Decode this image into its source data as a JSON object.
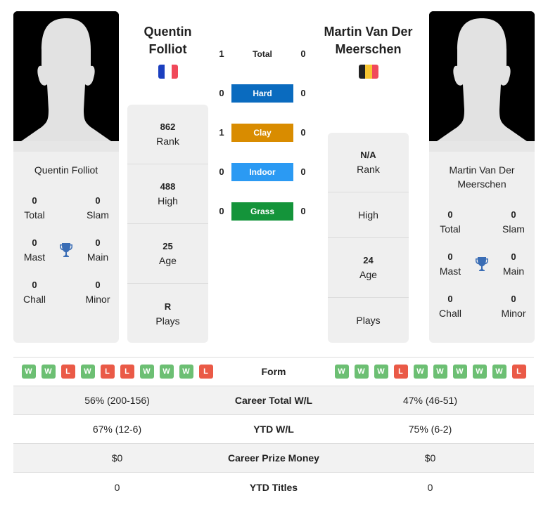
{
  "colors": {
    "hard": "#0a6bbf",
    "clay": "#d98c00",
    "indoor": "#2b9af3",
    "grass": "#14943a",
    "win": "#6cbf73",
    "loss": "#ea5a47",
    "trophy": "#3a6db5"
  },
  "player1": {
    "name": "Quentin Folliot",
    "name_line1": "Quentin",
    "name_line2": "Folliot",
    "flag": "France",
    "flag_colors": [
      "#1b3fbf",
      "#ffffff",
      "#f0495a"
    ],
    "card_name": "Quentin Folliot",
    "titles": {
      "total": {
        "value": "0",
        "label": "Total"
      },
      "slam": {
        "value": "0",
        "label": "Slam"
      },
      "mast": {
        "value": "0",
        "label": "Mast"
      },
      "main": {
        "value": "0",
        "label": "Main"
      },
      "chall": {
        "value": "0",
        "label": "Chall"
      },
      "minor": {
        "value": "0",
        "label": "Minor"
      }
    },
    "stats": {
      "rank": {
        "value": "862",
        "label": "Rank"
      },
      "high": {
        "value": "488",
        "label": "High"
      },
      "age": {
        "value": "25",
        "label": "Age"
      },
      "plays": {
        "value": "R",
        "label": "Plays"
      }
    }
  },
  "player2": {
    "name": "Martin Van Der Meerschen",
    "name_line1": "Martin Van Der",
    "name_line2": "Meerschen",
    "flag": "Belgium",
    "flag_colors": [
      "#222222",
      "#f7c531",
      "#f0495a"
    ],
    "card_name_line1": "Martin Van Der",
    "card_name_line2": "Meerschen",
    "titles": {
      "total": {
        "value": "0",
        "label": "Total"
      },
      "slam": {
        "value": "0",
        "label": "Slam"
      },
      "mast": {
        "value": "0",
        "label": "Mast"
      },
      "main": {
        "value": "0",
        "label": "Main"
      },
      "chall": {
        "value": "0",
        "label": "Chall"
      },
      "minor": {
        "value": "0",
        "label": "Minor"
      }
    },
    "stats": {
      "rank": {
        "value": "N/A",
        "label": "Rank"
      },
      "high": {
        "value": "",
        "label": "High"
      },
      "age": {
        "value": "24",
        "label": "Age"
      },
      "plays": {
        "value": "",
        "label": "Plays"
      }
    }
  },
  "h2h": [
    {
      "label": "Total",
      "p1": "1",
      "p2": "0",
      "surface": "total"
    },
    {
      "label": "Hard",
      "p1": "0",
      "p2": "0",
      "surface": "hard"
    },
    {
      "label": "Clay",
      "p1": "1",
      "p2": "0",
      "surface": "clay"
    },
    {
      "label": "Indoor",
      "p1": "0",
      "p2": "0",
      "surface": "indoor"
    },
    {
      "label": "Grass",
      "p1": "0",
      "p2": "0",
      "surface": "grass"
    }
  ],
  "table": {
    "form": {
      "label": "Form",
      "p1": [
        "W",
        "W",
        "L",
        "W",
        "L",
        "L",
        "W",
        "W",
        "W",
        "L"
      ],
      "p2": [
        "W",
        "W",
        "W",
        "L",
        "W",
        "W",
        "W",
        "W",
        "W",
        "L"
      ]
    },
    "rows": [
      {
        "label": "Career Total W/L",
        "p1": "56% (200-156)",
        "p2": "47% (46-51)"
      },
      {
        "label": "YTD W/L",
        "p1": "67% (12-6)",
        "p2": "75% (6-2)"
      },
      {
        "label": "Career Prize Money",
        "p1": "$0",
        "p2": "$0"
      },
      {
        "label": "YTD Titles",
        "p1": "0",
        "p2": "0"
      }
    ]
  }
}
